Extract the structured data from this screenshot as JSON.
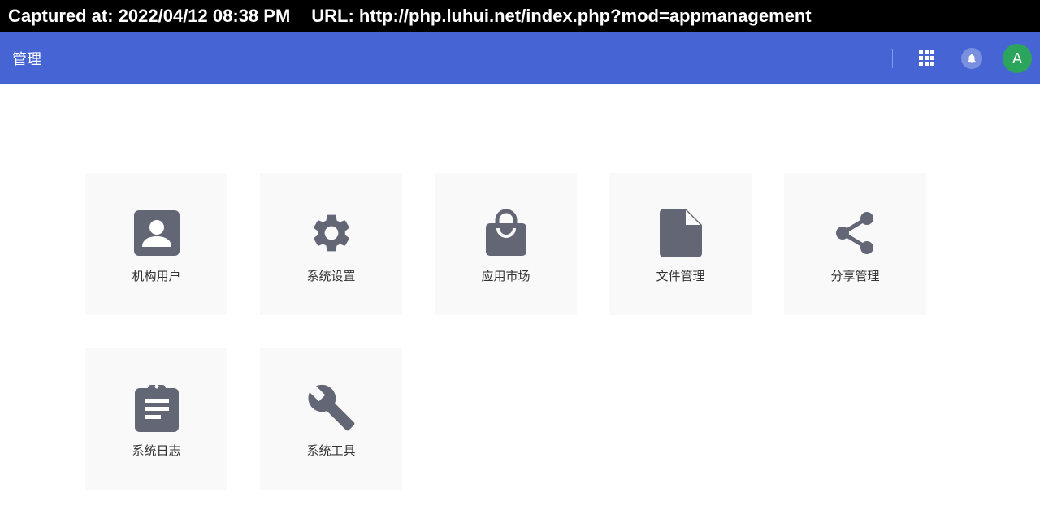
{
  "capture": {
    "captured_at": "Captured at: 2022/04/12 08:38 PM",
    "url": "URL: http://php.luhui.net/index.php?mod=appmanagement"
  },
  "header": {
    "title": "管理",
    "apps_icon": "apps-grid-icon",
    "notification_icon": "bell-icon",
    "avatar_letter": "A",
    "accent_color": "#4664d4",
    "avatar_color": "#2ba45c"
  },
  "tiles": [
    {
      "label": "机构用户",
      "icon": "account-box-icon"
    },
    {
      "label": "系统设置",
      "icon": "gear-icon"
    },
    {
      "label": "应用市场",
      "icon": "shopping-bag-icon"
    },
    {
      "label": "文件管理",
      "icon": "file-icon"
    },
    {
      "label": "分享管理",
      "icon": "share-icon"
    },
    {
      "label": "系统日志",
      "icon": "clipboard-icon"
    },
    {
      "label": "系统工具",
      "icon": "wrench-icon"
    }
  ],
  "icon_color": "#626675"
}
